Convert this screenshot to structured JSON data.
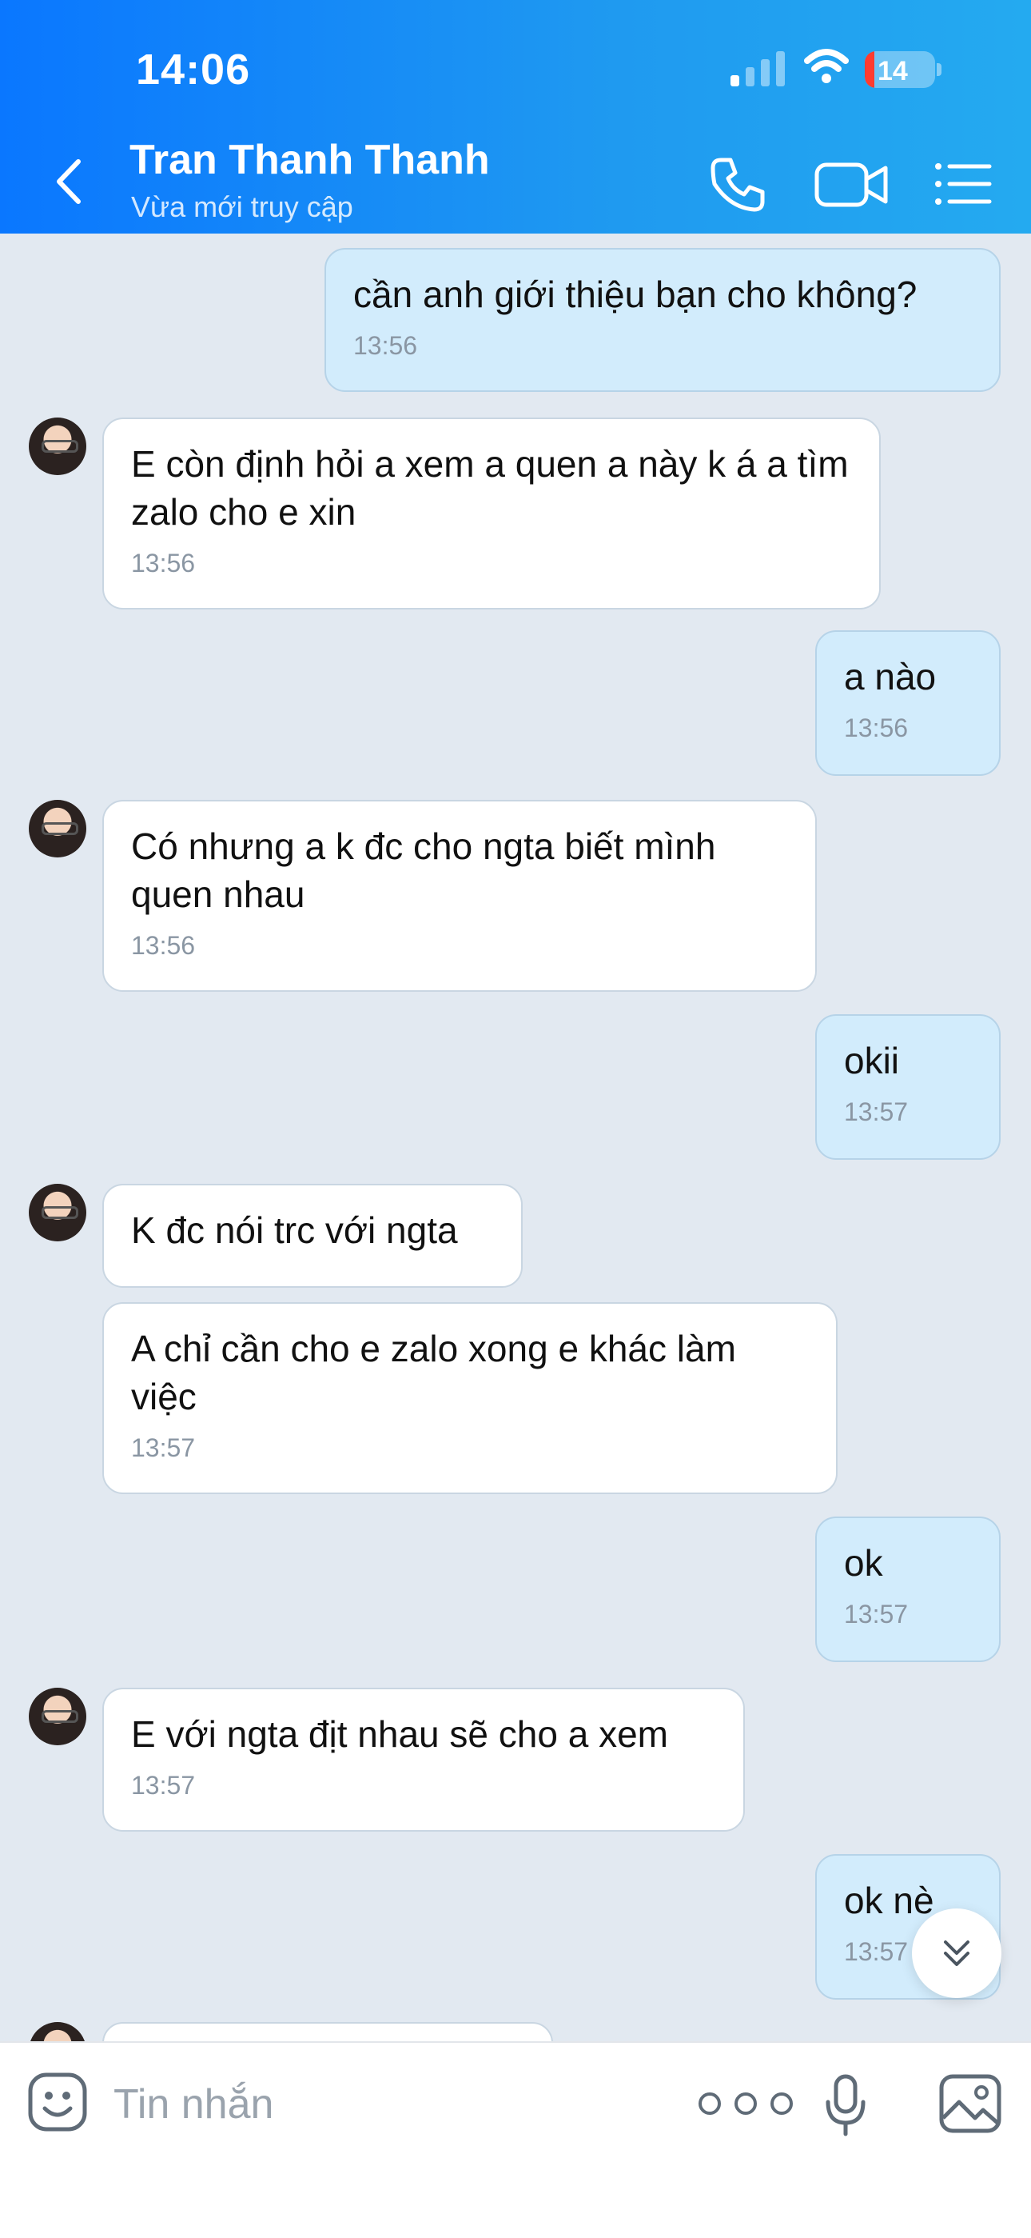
{
  "status_bar": {
    "time": "14:06",
    "battery": "14",
    "battery_percent": 14
  },
  "header": {
    "contact_name": "Tran Thanh Thanh",
    "contact_status": "Vừa mới truy cập",
    "icons": [
      "back-icon",
      "phone-icon",
      "video-call-icon",
      "menu-list-icon"
    ]
  },
  "messages": [
    {
      "sender": "me",
      "text": "cần anh giới thiệu bạn cho không?",
      "time": "13:56"
    },
    {
      "sender": "contact",
      "text": "E còn định hỏi a xem a quen a này k á a tìm zalo cho e xin",
      "time": "13:56"
    },
    {
      "sender": "me",
      "text": "a nào",
      "time": "13:56"
    },
    {
      "sender": "contact",
      "text": "Có nhưng a k đc cho ngta biết mình quen nhau",
      "time": "13:56"
    },
    {
      "sender": "me",
      "text": "okii",
      "time": "13:57"
    },
    {
      "sender": "contact",
      "text": "K đc nói trc với ngta",
      "time": ""
    },
    {
      "sender": "contact",
      "text": "A chỉ cần cho e zalo xong e khác làm việc",
      "time": "13:57"
    },
    {
      "sender": "me",
      "text": "ok",
      "time": "13:57"
    },
    {
      "sender": "contact",
      "text": "E với ngta địt nhau sẽ cho a xem",
      "time": "13:57"
    },
    {
      "sender": "me",
      "text": "ok nè",
      "time": "13:57"
    }
  ],
  "input_bar": {
    "placeholder": "Tin nhắn",
    "icons": [
      "emoji-icon",
      "more-options-icon",
      "microphone-icon",
      "image-icon"
    ]
  },
  "colors": {
    "header_gradient_start": "#0a77ff",
    "header_gradient_end": "#24aaf0",
    "chat_background": "#e2e9f1",
    "sent_bubble": "#d2ecfc",
    "received_bubble": "#ffffff",
    "battery_low": "#ff3b30"
  }
}
